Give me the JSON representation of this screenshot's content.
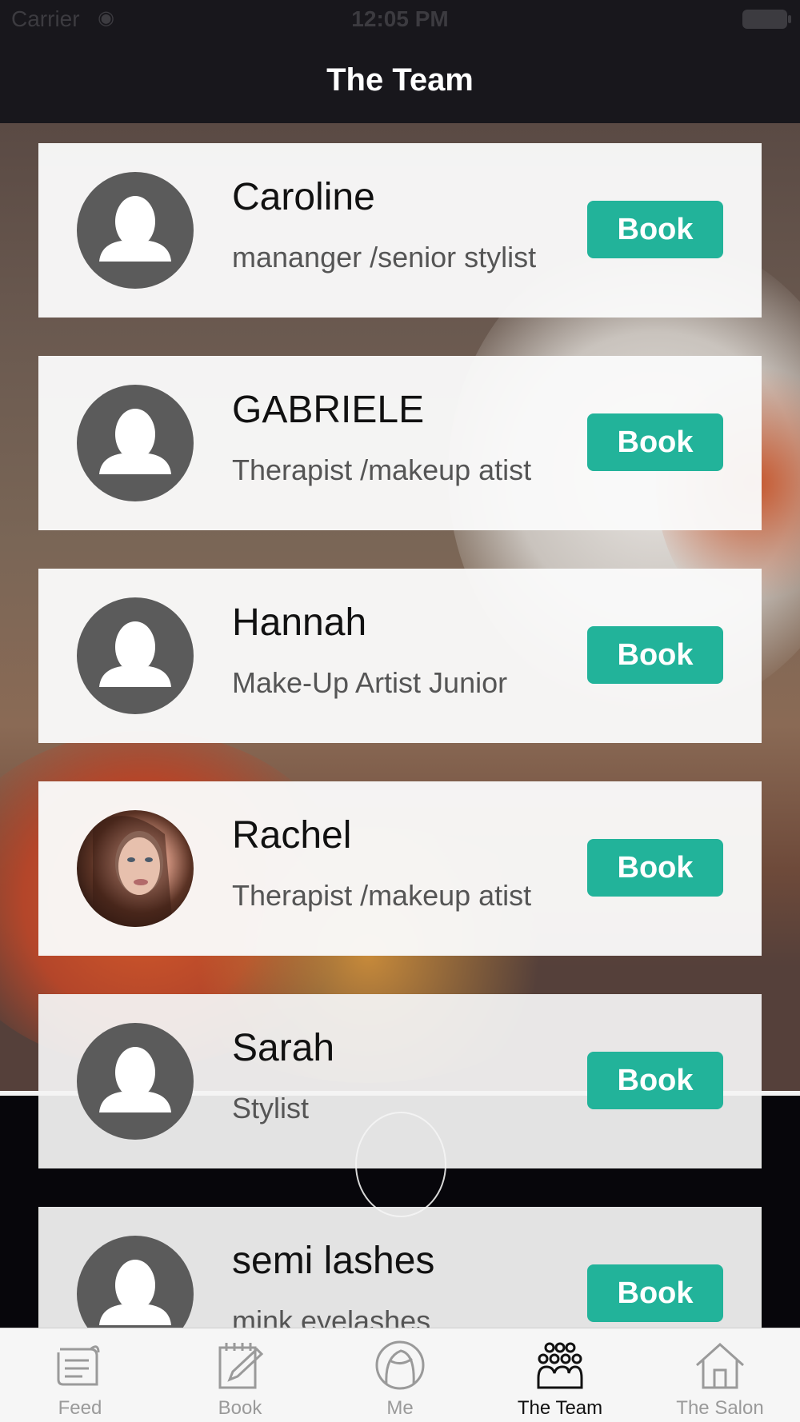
{
  "status_bar": {
    "carrier": "Carrier",
    "time": "12:05 PM"
  },
  "nav": {
    "title": "The Team"
  },
  "team": [
    {
      "name": "Caroline",
      "role": "mananger /senior stylist",
      "book_label": "Book",
      "avatar": "placeholder"
    },
    {
      "name": "GABRIELE",
      "role": "Therapist /makeup atist",
      "book_label": "Book",
      "avatar": "placeholder"
    },
    {
      "name": "Hannah",
      "role": "Make-Up Artist Junior",
      "book_label": "Book",
      "avatar": "placeholder"
    },
    {
      "name": "Rachel",
      "role": "Therapist /makeup atist",
      "book_label": "Book",
      "avatar": "photo"
    },
    {
      "name": "Sarah",
      "role": "Stylist",
      "book_label": "Book",
      "avatar": "placeholder"
    },
    {
      "name": "semi lashes",
      "role": "mink eyelashes",
      "book_label": "Book",
      "avatar": "placeholder"
    }
  ],
  "tabs": [
    {
      "label": "Feed",
      "icon": "feed-icon",
      "active": false
    },
    {
      "label": "Book",
      "icon": "book-icon",
      "active": false
    },
    {
      "label": "Me",
      "icon": "me-icon",
      "active": false
    },
    {
      "label": "The Team",
      "icon": "team-icon",
      "active": true
    },
    {
      "label": "The Salon",
      "icon": "salon-icon",
      "active": false
    }
  ],
  "colors": {
    "accent": "#22b39a",
    "nav_bg": "#18171c",
    "avatar_bg": "#5b5b5b"
  }
}
